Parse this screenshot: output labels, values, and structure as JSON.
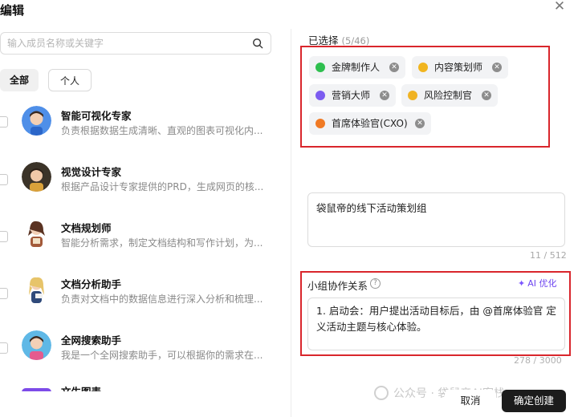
{
  "dialog": {
    "title": "编辑",
    "close_icon": "close-icon"
  },
  "search": {
    "placeholder": "输入成员名称或关键字",
    "icon": "search-icon"
  },
  "tabs": [
    {
      "label": "全部",
      "active": true
    },
    {
      "label": "个人",
      "active": false
    }
  ],
  "members": [
    {
      "name": "智能可视化专家",
      "desc": "负责根据数据生成清晰、直观的图表可视化内..."
    },
    {
      "name": "视觉设计专家",
      "desc": "根据产品设计专家提供的PRD，生成网页的核..."
    },
    {
      "name": "文档规划师",
      "desc": "智能分析需求，制定文档结构和写作计划，为..."
    },
    {
      "name": "文档分析助手",
      "desc": "负责对文档中的数据信息进行深入分析和梳理..."
    },
    {
      "name": "全网搜索助手",
      "desc": "我是一个全网搜索助手，可以根据你的需求在..."
    },
    {
      "name": "文生图表",
      "desc": ""
    }
  ],
  "selected": {
    "label": "已选择",
    "count": "(5/46)",
    "chips": [
      {
        "label": "金牌制作人",
        "color": "#2fbf4f"
      },
      {
        "label": "内容策划师",
        "color": "#f1b51f"
      },
      {
        "label": "营销大师",
        "color": "#7c5cf0"
      },
      {
        "label": "风险控制官",
        "color": "#f0b323"
      },
      {
        "label": "首席体验官(CXO)",
        "color": "#f07a24"
      }
    ]
  },
  "group_name": {
    "value": "袋鼠帝的线下活动策划组",
    "count": "11 / 512"
  },
  "collab": {
    "label": "小组协作关系",
    "ai_button": "AI 优化",
    "text": "1. 启动会：用户提出活动目标后，由 @首席体验官 定义活动主题与核心体验。",
    "count": "278 / 3000"
  },
  "watermark": "公众号 · 袋鼠帝AI客栈",
  "footer": {
    "cancel": "取消",
    "confirm": "确定创建"
  }
}
